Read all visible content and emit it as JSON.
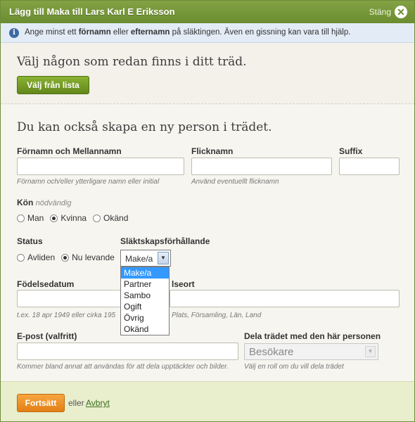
{
  "header": {
    "title": "Lägg till Maka till Lars Karl E Eriksson",
    "close_label": "Stäng"
  },
  "info": {
    "part1": "Ange minst ett ",
    "bold1": "förnamn",
    "part2": " eller ",
    "bold2": "efternamn",
    "part3": " på släktingen. Även en gissning kan vara till hjälp."
  },
  "existing": {
    "heading": "Välj någon som redan finns i ditt träd.",
    "button": "Välj från lista"
  },
  "create": {
    "heading": "Du kan också skapa en ny person i trädet.",
    "first_name_label": "Förnamn och Mellannamn",
    "first_name_hint": "Förnamn och/eller ytterligare namn eller initial",
    "nickname_label": "Flicknamn",
    "nickname_hint": "Använd eventuellt flicknamn",
    "suffix_label": "Suffix",
    "gender_label": "Kön",
    "gender_required": "nödvändig",
    "gender_options": [
      "Man",
      "Kvinna",
      "Okänd"
    ],
    "gender_selected": "Kvinna",
    "status_label": "Status",
    "status_options": [
      "Avliden",
      "Nu levande"
    ],
    "status_selected": "Nu levande",
    "relation_label": "Släktskapsförhållande",
    "relation_value": "Make/a",
    "relation_options": [
      "Make/a",
      "Partner",
      "Sambo",
      "Ogift",
      "Övrig",
      "Okänd"
    ],
    "birthdate_label": "Födelsedatum",
    "birthdate_hint": "t.ex. 18 apr 1949 eller cirka 195",
    "birthplace_label": "lseort",
    "birthplace_hint": "Plats, Församling, Län, Land",
    "email_label": "E-post (valfritt)",
    "email_hint": "Kommer bland annat att användas för att dela upptäckter och bilder.",
    "share_label": "Dela trädet med den här personen",
    "share_value": "Besökare",
    "share_hint": "Välj en roll om du vill dela trädet"
  },
  "footer": {
    "continue_label": "Fortsätt",
    "or_text": "eller",
    "cancel_label": "Avbryt"
  },
  "colors": {
    "title_bar": "#6b8c30",
    "primary_button": "#63871b",
    "continue_button": "#e27f14",
    "info_bar": "#e3ecf6",
    "selected_option": "#3399ff"
  },
  "icons": {
    "close": "close-x-circle-icon",
    "info": "info-icon",
    "dropdown": "chevron-down-icon"
  }
}
